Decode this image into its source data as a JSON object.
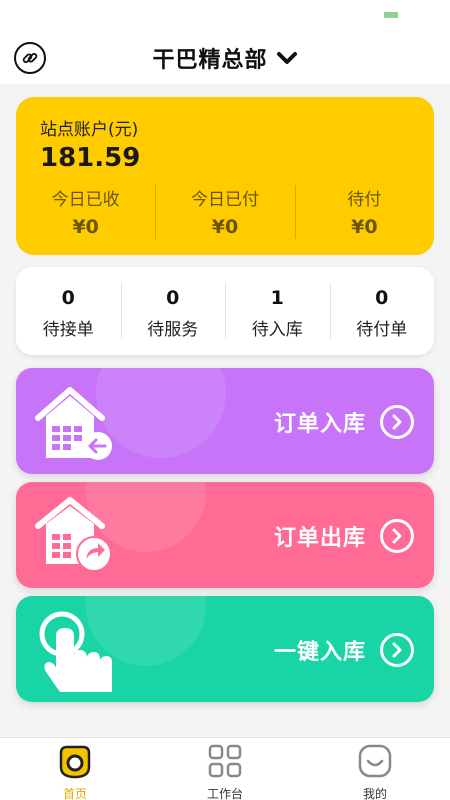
{
  "header": {
    "title": "干巴精总部"
  },
  "account": {
    "label": "站点账户(元)",
    "amount": "181.59",
    "stats": [
      {
        "label": "今日已收",
        "value": "¥0"
      },
      {
        "label": "今日已付",
        "value": "¥0"
      },
      {
        "label": "待付",
        "value": "¥0"
      }
    ]
  },
  "status": [
    {
      "count": "0",
      "label": "待接单"
    },
    {
      "count": "0",
      "label": "待服务"
    },
    {
      "count": "1",
      "label": "待入库"
    },
    {
      "count": "0",
      "label": "待付单"
    }
  ],
  "actions": [
    {
      "label": "订单入库",
      "color": "#c774f8",
      "icon": "house-inbound-icon"
    },
    {
      "label": "订单出库",
      "color": "#ff6b95",
      "icon": "house-outbound-icon"
    },
    {
      "label": "一键入库",
      "color": "#19d4a4",
      "icon": "hand-tap-icon"
    }
  ],
  "tabbar": {
    "active_color": "#e0a800",
    "tabs": [
      {
        "label": "首页",
        "icon": "home-icon"
      },
      {
        "label": "工作台",
        "icon": "grid-icon"
      },
      {
        "label": "我的",
        "icon": "smile-icon"
      }
    ]
  }
}
